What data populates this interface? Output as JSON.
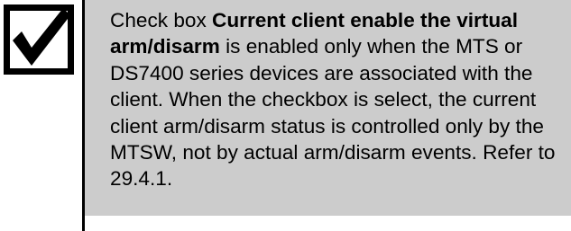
{
  "note": {
    "icon": "checkbox-checked-icon",
    "text_before": "Check box ",
    "bold_text": "Current client enable the virtual arm/disarm",
    "text_after": " is enabled only when the MTS or DS7400 series devices are associated with the client. When the checkbox is select, the current client arm/disarm status is controlled only by the MTSW, not by actual arm/disarm events. Refer to 29.4.1."
  },
  "colors": {
    "panel_background": "#cccccc",
    "icon_background": "#ffffff",
    "border": "#000000"
  }
}
